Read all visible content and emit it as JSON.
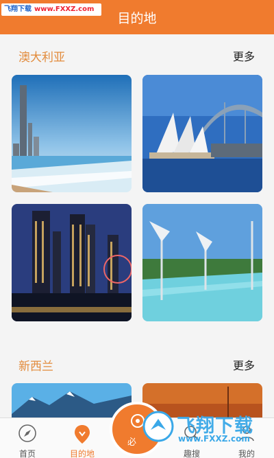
{
  "header": {
    "title": "目的地"
  },
  "watermark_top": {
    "site_name": "飞翔下载",
    "site_url": "www.FXXZ.com"
  },
  "sections": [
    {
      "title": "澳大利亚",
      "more": "更多"
    },
    {
      "title": "新西兰",
      "more": "更多"
    }
  ],
  "cards": [
    {
      "icon": "beach-skyline-photo"
    },
    {
      "icon": "opera-house-photo"
    },
    {
      "icon": "night-city-photo"
    },
    {
      "icon": "lagoon-sculpture-photo"
    },
    {
      "icon": "snow-mountain-photo"
    },
    {
      "icon": "sunset-tower-photo"
    }
  ],
  "tabbar": {
    "tabs": [
      {
        "label": "首页",
        "icon": "compass-icon"
      },
      {
        "label": "目的地",
        "icon": "location-pin-icon"
      },
      {
        "label": "趣搜",
        "icon": "search-icon"
      },
      {
        "label": "我的",
        "icon": "user-icon"
      }
    ],
    "center_label": "必"
  },
  "watermark_bottom": {
    "site_name": "飞翔下载",
    "site_url": "www.FXXZ.com"
  },
  "colors": {
    "accent": "#f07b2e",
    "section_title": "#e28b3c",
    "watermark": "#3aa8e8"
  }
}
